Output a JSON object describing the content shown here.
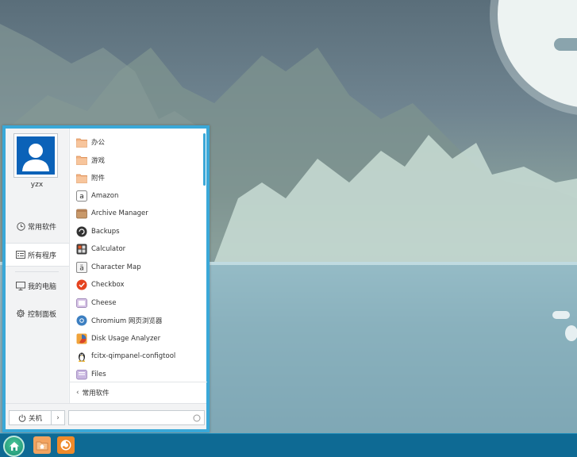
{
  "user": {
    "name": "yzx"
  },
  "nav": {
    "common": "常用软件",
    "all": "所有程序",
    "computer": "我的电脑",
    "control": "控制面板"
  },
  "apps": [
    {
      "label": "办公",
      "icon": "folder-icon"
    },
    {
      "label": "游戏",
      "icon": "folder-icon"
    },
    {
      "label": "附件",
      "icon": "folder-icon"
    },
    {
      "label": "Amazon",
      "icon": "amazon-icon"
    },
    {
      "label": "Archive Manager",
      "icon": "archive-manager-icon"
    },
    {
      "label": "Backups",
      "icon": "backups-icon"
    },
    {
      "label": "Calculator",
      "icon": "calculator-icon"
    },
    {
      "label": "Character Map",
      "icon": "character-map-icon"
    },
    {
      "label": "Checkbox",
      "icon": "checkbox-icon"
    },
    {
      "label": "Cheese",
      "icon": "cheese-icon"
    },
    {
      "label": "Chromium 网页浏览器",
      "icon": "chromium-icon"
    },
    {
      "label": "Disk Usage Analyzer",
      "icon": "disk-usage-icon"
    },
    {
      "label": "fcitx-qimpanel-configtool",
      "icon": "tux-icon"
    },
    {
      "label": "Files",
      "icon": "files-icon"
    }
  ],
  "back": {
    "label": "常用软件"
  },
  "power": {
    "label": "关机",
    "arrow": "›"
  },
  "search": {
    "placeholder": ""
  },
  "colors": {
    "accent": "#3aa8d8",
    "taskbar": "#0e6a94",
    "folder": "#f0a86a"
  }
}
